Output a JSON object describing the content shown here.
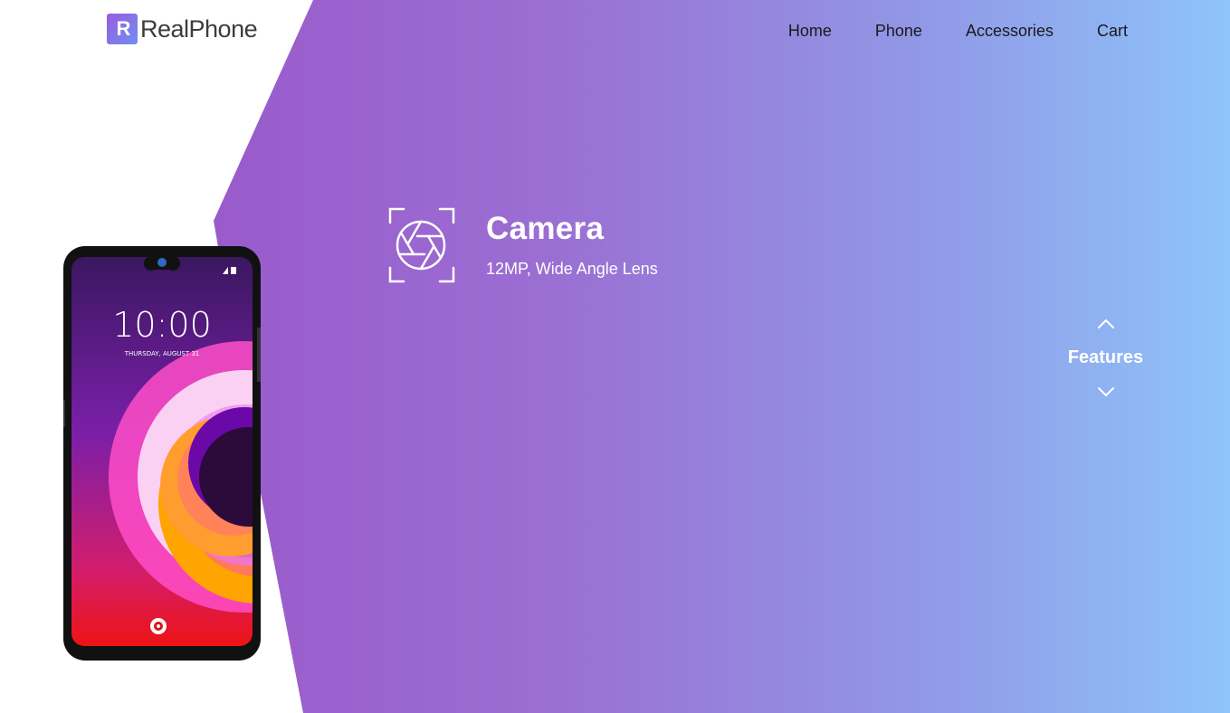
{
  "brand": {
    "mark": "R",
    "name": "RealPhone"
  },
  "nav": {
    "items": [
      "Home",
      "Phone",
      "Accessories",
      "Cart"
    ]
  },
  "phone_screen": {
    "time": "10:00",
    "date": "THURSDAY, AUGUST 31"
  },
  "feature": {
    "title": "Camera",
    "subtitle": "12MP, Wide Angle Lens",
    "icon": "camera-aperture-icon"
  },
  "pager": {
    "label": "Features",
    "up_icon": "chevron-up-icon",
    "down_icon": "chevron-down-icon"
  },
  "colors": {
    "gradient_start": "#9a4dc6",
    "gradient_end": "#8ec4fa",
    "nav_text": "#1a1a1a",
    "hero_text": "#ffffff"
  }
}
